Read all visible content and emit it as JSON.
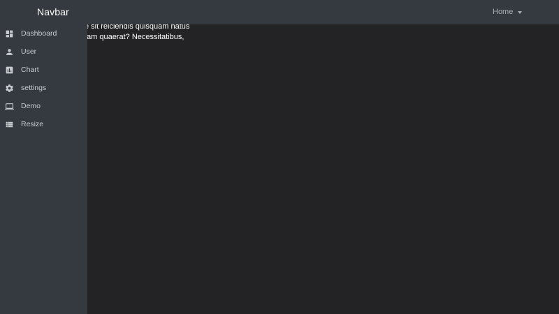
{
  "navbar": {
    "brand": "Navbar",
    "home_label": "Home"
  },
  "content": {
    "line1": "e sit reiciendis quisquam natus",
    "line2": "am quaerat? Necessitatibus,"
  },
  "sidebar": {
    "items": [
      {
        "label": "Dashboard",
        "icon": "dashboard-icon"
      },
      {
        "label": "User",
        "icon": "user-icon"
      },
      {
        "label": "Chart",
        "icon": "chart-icon"
      },
      {
        "label": "settings",
        "icon": "gear-icon"
      },
      {
        "label": "Demo",
        "icon": "laptop-icon"
      },
      {
        "label": "Resize",
        "icon": "list-icon"
      }
    ]
  },
  "colors": {
    "navbar_bg": "#343a40",
    "sidebar_bg": "#343a40",
    "page_bg": "#232224",
    "text_light": "#c8ccd0"
  }
}
